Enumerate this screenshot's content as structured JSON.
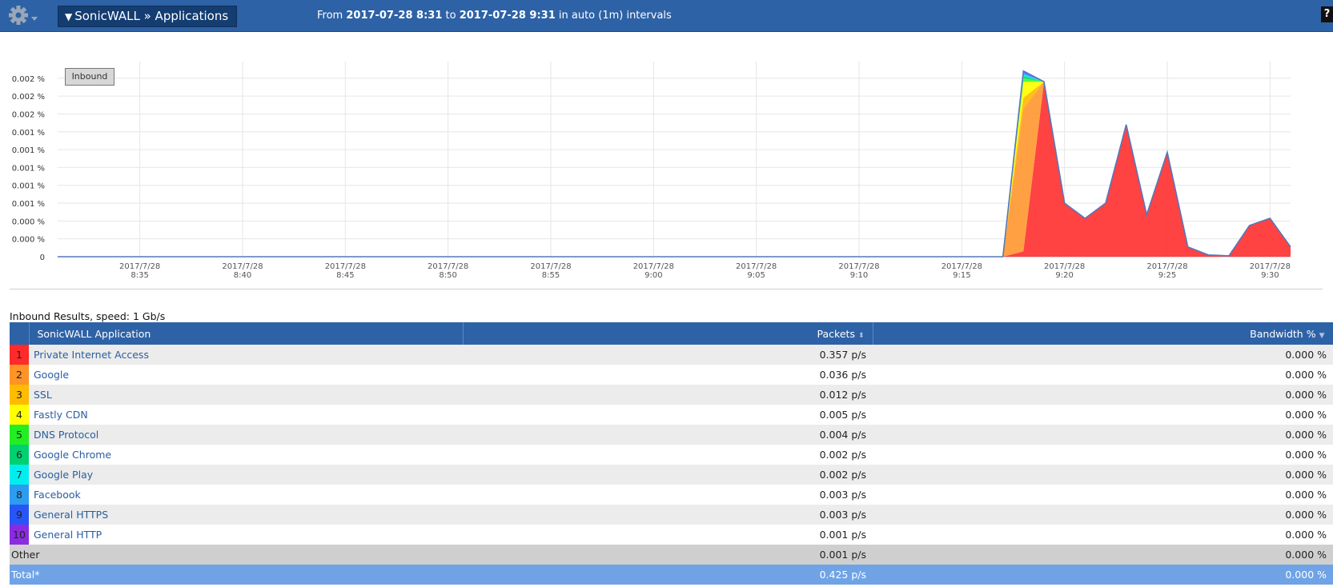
{
  "header": {
    "title": "SonicWALL » Applications",
    "range_from_label": "From",
    "range_from": "2017-07-28 8:31",
    "range_to_label": "to",
    "range_to": "2017-07-28 9:31",
    "range_suffix": "in auto (1m) intervals",
    "help_label": "?"
  },
  "chart": {
    "legend_button": "Inbound"
  },
  "chart_data": {
    "type": "area",
    "stacked": true,
    "y_tick_labels": [
      "0",
      "0.000 %",
      "0.000 %",
      "0.001 %",
      "0.001 %",
      "0.001 %",
      "0.001 %",
      "0.001 %",
      "0.002 %",
      "0.002 %",
      "0.002 %"
    ],
    "ylim": [
      0,
      0.00215
    ],
    "x_tick_labels": [
      [
        "2017/7/28",
        "8:35"
      ],
      [
        "2017/7/28",
        "8:40"
      ],
      [
        "2017/7/28",
        "8:45"
      ],
      [
        "2017/7/28",
        "8:50"
      ],
      [
        "2017/7/28",
        "8:55"
      ],
      [
        "2017/7/28",
        "9:00"
      ],
      [
        "2017/7/28",
        "9:05"
      ],
      [
        "2017/7/28",
        "9:10"
      ],
      [
        "2017/7/28",
        "9:15"
      ],
      [
        "2017/7/28",
        "9:20"
      ],
      [
        "2017/7/28",
        "9:25"
      ],
      [
        "2017/7/28",
        "9:30"
      ]
    ],
    "x": [
      "8:31",
      "8:32",
      "8:33",
      "8:34",
      "8:35",
      "8:36",
      "8:37",
      "8:38",
      "8:39",
      "8:40",
      "8:41",
      "8:42",
      "8:43",
      "8:44",
      "8:45",
      "8:46",
      "8:47",
      "8:48",
      "8:49",
      "8:50",
      "8:51",
      "8:52",
      "8:53",
      "8:54",
      "8:55",
      "8:56",
      "8:57",
      "8:58",
      "8:59",
      "9:00",
      "9:01",
      "9:02",
      "9:03",
      "9:04",
      "9:05",
      "9:06",
      "9:07",
      "9:08",
      "9:09",
      "9:10",
      "9:11",
      "9:12",
      "9:13",
      "9:14",
      "9:15",
      "9:16",
      "9:17",
      "9:18",
      "9:19",
      "9:20",
      "9:21",
      "9:22",
      "9:23",
      "9:24",
      "9:25",
      "9:26",
      "9:27",
      "9:28",
      "9:29",
      "9:30",
      "9:31"
    ],
    "grid": true,
    "series": [
      {
        "name": "Private Internet Access",
        "color": "#ff3333",
        "values": [
          0,
          0,
          0,
          0,
          0,
          0,
          0,
          0,
          0,
          0,
          0,
          0,
          0,
          0,
          0,
          0,
          0,
          0,
          0,
          0,
          0,
          0,
          0,
          0,
          0,
          0,
          0,
          0,
          0,
          0,
          0,
          0,
          0,
          0,
          0,
          0,
          0,
          0,
          0,
          0,
          0,
          0,
          0,
          0,
          0,
          0,
          0,
          6e-05,
          0.00196,
          0.0006,
          0.00043,
          0.0006,
          0.00148,
          0.00047,
          0.00117,
          0.00011,
          2e-05,
          1e-05,
          0.00035,
          0.00043,
          0.00011
        ]
      },
      {
        "name": "Google",
        "color": "#ff9933",
        "values": [
          0,
          0,
          0,
          0,
          0,
          0,
          0,
          0,
          0,
          0,
          0,
          0,
          0,
          0,
          0,
          0,
          0,
          0,
          0,
          0,
          0,
          0,
          0,
          0,
          0,
          0,
          0,
          0,
          0,
          0,
          0,
          0,
          0,
          0,
          0,
          0,
          0,
          0,
          0,
          0,
          0,
          0,
          0,
          0,
          0,
          0,
          0,
          0.0016,
          0,
          0,
          0,
          0,
          0,
          0,
          0,
          0,
          0,
          0,
          0,
          0,
          0
        ]
      },
      {
        "name": "SSL",
        "color": "#ffbb00",
        "values": [
          0,
          0,
          0,
          0,
          0,
          0,
          0,
          0,
          0,
          0,
          0,
          0,
          0,
          0,
          0,
          0,
          0,
          0,
          0,
          0,
          0,
          0,
          0,
          0,
          0,
          0,
          0,
          0,
          0,
          0,
          0,
          0,
          0,
          0,
          0,
          0,
          0,
          0,
          0,
          0,
          0,
          0,
          0,
          0,
          0,
          0,
          0,
          0.00012,
          0,
          0,
          0,
          0,
          0,
          0,
          0,
          0,
          0,
          0,
          0,
          0,
          0
        ]
      },
      {
        "name": "Fastly CDN",
        "color": "#ffff00",
        "values": [
          0,
          0,
          0,
          0,
          0,
          0,
          0,
          0,
          0,
          0,
          0,
          0,
          0,
          0,
          0,
          0,
          0,
          0,
          0,
          0,
          0,
          0,
          0,
          0,
          0,
          0,
          0,
          0,
          0,
          0,
          0,
          0,
          0,
          0,
          0,
          0,
          0,
          0,
          0,
          0,
          0,
          0,
          0,
          0,
          0,
          0,
          0,
          0.00018,
          0,
          0,
          0,
          0,
          0,
          0,
          0,
          0,
          0,
          0,
          0,
          0,
          0
        ]
      },
      {
        "name": "DNS Protocol",
        "color": "#33ff33",
        "values": [
          0,
          0,
          0,
          0,
          0,
          0,
          0,
          0,
          0,
          0,
          0,
          0,
          0,
          0,
          0,
          0,
          0,
          0,
          0,
          0,
          0,
          0,
          0,
          0,
          0,
          0,
          0,
          0,
          0,
          0,
          0,
          0,
          0,
          0,
          0,
          0,
          0,
          0,
          0,
          0,
          0,
          0,
          0,
          0,
          0,
          0,
          0,
          4e-05,
          0,
          0,
          0,
          0,
          0,
          0,
          0,
          0,
          0,
          0,
          0,
          0,
          0
        ]
      },
      {
        "name": "Google Chrome",
        "color": "#00cc66",
        "values": [
          0,
          0,
          0,
          0,
          0,
          0,
          0,
          0,
          0,
          0,
          0,
          0,
          0,
          0,
          0,
          0,
          0,
          0,
          0,
          0,
          0,
          0,
          0,
          0,
          0,
          0,
          0,
          0,
          0,
          0,
          0,
          0,
          0,
          0,
          0,
          0,
          0,
          0,
          0,
          0,
          0,
          0,
          0,
          0,
          0,
          0,
          0,
          2e-05,
          0,
          0,
          0,
          0,
          0,
          0,
          0,
          0,
          0,
          0,
          0,
          0,
          0
        ]
      },
      {
        "name": "Google Play",
        "color": "#00e5e5",
        "values": [
          0,
          0,
          0,
          0,
          0,
          0,
          0,
          0,
          0,
          0,
          0,
          0,
          0,
          0,
          0,
          0,
          0,
          0,
          0,
          0,
          0,
          0,
          0,
          0,
          0,
          0,
          0,
          0,
          0,
          0,
          0,
          0,
          0,
          0,
          0,
          0,
          0,
          0,
          0,
          0,
          0,
          0,
          0,
          0,
          0,
          0,
          0,
          2e-05,
          0,
          0,
          0,
          0,
          0,
          0,
          0,
          0,
          0,
          0,
          0,
          0,
          0
        ]
      },
      {
        "name": "Facebook",
        "color": "#3399ff",
        "values": [
          0,
          0,
          0,
          0,
          0,
          0,
          0,
          0,
          0,
          0,
          0,
          0,
          0,
          0,
          0,
          0,
          0,
          0,
          0,
          0,
          0,
          0,
          0,
          0,
          0,
          0,
          0,
          0,
          0,
          0,
          0,
          0,
          0,
          0,
          0,
          0,
          0,
          0,
          0,
          0,
          0,
          0,
          0,
          0,
          0,
          0,
          0,
          2e-05,
          0,
          0,
          0,
          0,
          0,
          0,
          0,
          0,
          0,
          0,
          0,
          0,
          0
        ]
      },
      {
        "name": "General HTTPS",
        "color": "#3355ff",
        "values": [
          0,
          0,
          0,
          0,
          0,
          0,
          0,
          0,
          0,
          0,
          0,
          0,
          0,
          0,
          0,
          0,
          0,
          0,
          0,
          0,
          0,
          0,
          0,
          0,
          0,
          0,
          0,
          0,
          0,
          0,
          0,
          0,
          0,
          0,
          0,
          0,
          0,
          0,
          0,
          0,
          0,
          0,
          0,
          0,
          0,
          0,
          0,
          1e-05,
          0,
          0,
          0,
          0,
          0,
          0,
          0,
          0,
          0,
          0,
          0,
          0,
          0
        ]
      },
      {
        "name": "General HTTP",
        "color": "#8833ff",
        "values": [
          0,
          0,
          0,
          0,
          0,
          0,
          0,
          0,
          0,
          0,
          0,
          0,
          0,
          0,
          0,
          0,
          0,
          0,
          0,
          0,
          0,
          0,
          0,
          0,
          0,
          0,
          0,
          0,
          0,
          0,
          0,
          0,
          0,
          0,
          0,
          0,
          0,
          0,
          0,
          0,
          0,
          0,
          0,
          0,
          0,
          0,
          0,
          1e-05,
          0,
          0,
          0,
          0,
          0,
          0,
          0,
          0,
          0,
          0,
          0,
          0,
          0
        ]
      }
    ]
  },
  "results": {
    "label": "Inbound Results, speed: 1 Gb/s",
    "columns": {
      "application": "SonicWALL Application",
      "packets": "Packets",
      "bandwidth": "Bandwidth %"
    },
    "rows": [
      {
        "rank": "1",
        "color": "#ff2a2a",
        "name": "Private Internet Access",
        "packets": "0.357 p/s",
        "bandwidth": "0.000 %"
      },
      {
        "rank": "2",
        "color": "#ff9326",
        "name": "Google",
        "packets": "0.036 p/s",
        "bandwidth": "0.000 %"
      },
      {
        "rank": "3",
        "color": "#ffbb00",
        "name": "SSL",
        "packets": "0.012 p/s",
        "bandwidth": "0.000 %"
      },
      {
        "rank": "4",
        "color": "#ffff00",
        "name": "Fastly CDN",
        "packets": "0.005 p/s",
        "bandwidth": "0.000 %"
      },
      {
        "rank": "5",
        "color": "#22ee22",
        "name": "DNS Protocol",
        "packets": "0.004 p/s",
        "bandwidth": "0.000 %"
      },
      {
        "rank": "6",
        "color": "#00d070",
        "name": "Google Chrome",
        "packets": "0.002 p/s",
        "bandwidth": "0.000 %"
      },
      {
        "rank": "7",
        "color": "#00eeee",
        "name": "Google Play",
        "packets": "0.002 p/s",
        "bandwidth": "0.000 %"
      },
      {
        "rank": "8",
        "color": "#2c9cf0",
        "name": "Facebook",
        "packets": "0.003 p/s",
        "bandwidth": "0.000 %"
      },
      {
        "rank": "9",
        "color": "#2855f5",
        "name": "General HTTPS",
        "packets": "0.003 p/s",
        "bandwidth": "0.000 %"
      },
      {
        "rank": "10",
        "color": "#8a2be2",
        "name": "General HTTP",
        "packets": "0.001 p/s",
        "bandwidth": "0.000 %"
      }
    ],
    "other": {
      "name": "Other",
      "packets": "0.001 p/s",
      "bandwidth": "0.000 %"
    },
    "total": {
      "name": "Total*",
      "packets": "0.425 p/s",
      "bandwidth": "0.000 %"
    }
  }
}
